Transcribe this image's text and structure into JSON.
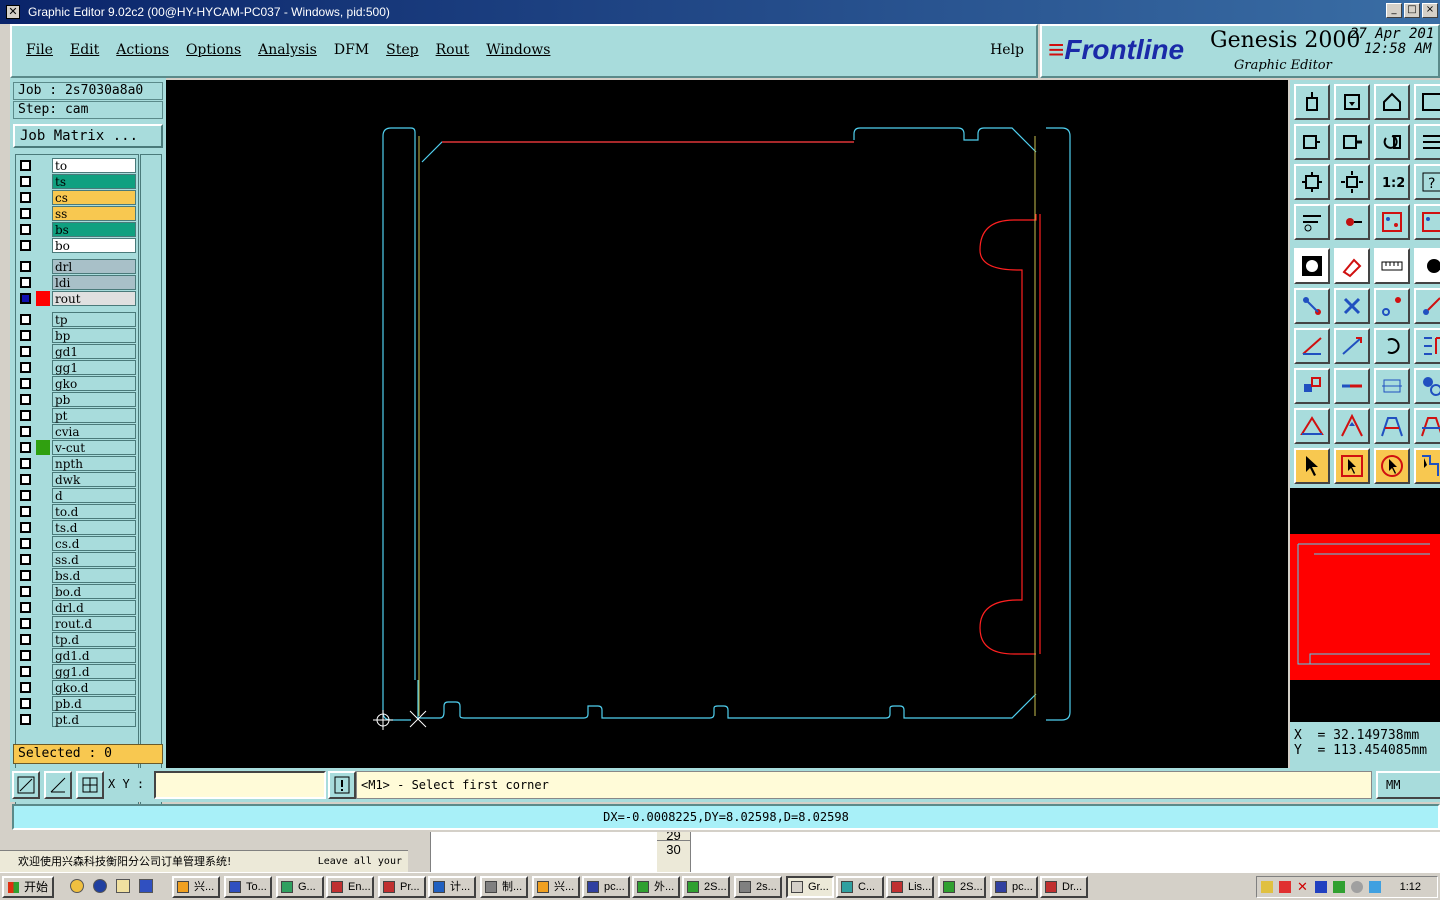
{
  "window": {
    "title": "Graphic Editor 9.02c2 (00@HY-HYCAM-PC037 - Windows, pid:500)",
    "controls": [
      "_",
      "□",
      "×"
    ]
  },
  "menu": {
    "items": [
      "File",
      "Edit",
      "Actions",
      "Options",
      "Analysis",
      "DFM",
      "Step",
      "Rout",
      "Windows"
    ],
    "help": "Help"
  },
  "brand": {
    "logo": "Frontline",
    "product": "Genesis 2000",
    "subtitle": "Graphic Editor",
    "date": "27 Apr 201",
    "time": "12:58 AM"
  },
  "job": {
    "job_label": "Job : 2s7030a8a0",
    "step_label": "Step: cam",
    "matrix_button": "Job Matrix ..."
  },
  "layers": [
    {
      "name": "to",
      "color": "#ffffff",
      "selected": false,
      "swatch": ""
    },
    {
      "name": "ts",
      "color": "#10a080",
      "selected": false,
      "swatch": ""
    },
    {
      "name": "cs",
      "color": "#f8c850",
      "selected": false,
      "swatch": ""
    },
    {
      "name": "ss",
      "color": "#f8c850",
      "selected": false,
      "swatch": ""
    },
    {
      "name": "bs",
      "color": "#10a080",
      "selected": false,
      "swatch": ""
    },
    {
      "name": "bo",
      "color": "#ffffff",
      "selected": false,
      "swatch": ""
    },
    {
      "name": "drl",
      "color": "#a8c0c8",
      "selected": false,
      "swatch": ""
    },
    {
      "name": "ldi",
      "color": "#a8c0c8",
      "selected": false,
      "swatch": ""
    },
    {
      "name": "rout",
      "color": "#e0e0e0",
      "selected": true,
      "swatch": "#ff0000"
    },
    {
      "name": "tp",
      "color": "#a8dcdc",
      "selected": false,
      "swatch": ""
    },
    {
      "name": "bp",
      "color": "#a8dcdc",
      "selected": false,
      "swatch": ""
    },
    {
      "name": "gd1",
      "color": "#a8dcdc",
      "selected": false,
      "swatch": ""
    },
    {
      "name": "gg1",
      "color": "#a8dcdc",
      "selected": false,
      "swatch": ""
    },
    {
      "name": "gko",
      "color": "#a8dcdc",
      "selected": false,
      "swatch": ""
    },
    {
      "name": "pb",
      "color": "#a8dcdc",
      "selected": false,
      "swatch": ""
    },
    {
      "name": "pt",
      "color": "#a8dcdc",
      "selected": false,
      "swatch": ""
    },
    {
      "name": "cvia",
      "color": "#a8dcdc",
      "selected": false,
      "swatch": ""
    },
    {
      "name": "v-cut",
      "color": "#a8dcdc",
      "selected": false,
      "swatch": "#30a010"
    },
    {
      "name": "npth",
      "color": "#a8dcdc",
      "selected": false,
      "swatch": ""
    },
    {
      "name": "dwk",
      "color": "#a8dcdc",
      "selected": false,
      "swatch": ""
    },
    {
      "name": "d",
      "color": "#a8dcdc",
      "selected": false,
      "swatch": ""
    },
    {
      "name": "to.d",
      "color": "#a8dcdc",
      "selected": false,
      "swatch": ""
    },
    {
      "name": "ts.d",
      "color": "#a8dcdc",
      "selected": false,
      "swatch": ""
    },
    {
      "name": "cs.d",
      "color": "#a8dcdc",
      "selected": false,
      "swatch": ""
    },
    {
      "name": "ss.d",
      "color": "#a8dcdc",
      "selected": false,
      "swatch": ""
    },
    {
      "name": "bs.d",
      "color": "#a8dcdc",
      "selected": false,
      "swatch": ""
    },
    {
      "name": "bo.d",
      "color": "#a8dcdc",
      "selected": false,
      "swatch": ""
    },
    {
      "name": "drl.d",
      "color": "#a8dcdc",
      "selected": false,
      "swatch": ""
    },
    {
      "name": "rout.d",
      "color": "#a8dcdc",
      "selected": false,
      "swatch": ""
    },
    {
      "name": "tp.d",
      "color": "#a8dcdc",
      "selected": false,
      "swatch": ""
    },
    {
      "name": "gd1.d",
      "color": "#a8dcdc",
      "selected": false,
      "swatch": ""
    },
    {
      "name": "gg1.d",
      "color": "#a8dcdc",
      "selected": false,
      "swatch": ""
    },
    {
      "name": "gko.d",
      "color": "#a8dcdc",
      "selected": false,
      "swatch": ""
    },
    {
      "name": "pb.d",
      "color": "#a8dcdc",
      "selected": false,
      "swatch": ""
    },
    {
      "name": "pt.d",
      "color": "#a8dcdc",
      "selected": false,
      "swatch": ""
    }
  ],
  "selected_label": "Selected : 0",
  "coords": {
    "x": "X  = 32.149738mm",
    "y": "Y  = 113.454085mm"
  },
  "command": {
    "xy_label": "X Y :",
    "xy_value": "",
    "prompt": "<M1> - Select first corner",
    "units": "MM"
  },
  "measure": "DX=-0.0008225,DY=8.02598,D=8.02598",
  "background_window": {
    "message": "欢迎使用兴森科技衡阳分公司订单管理系统!",
    "message_right": "Leave all your",
    "row_29": "29",
    "row_30": "30"
  },
  "taskbar": {
    "start": "开始",
    "tasks": [
      "兴...",
      "To...",
      "G...",
      "En...",
      "Pr...",
      "计...",
      "制...",
      "兴...",
      "pc...",
      "外...",
      "2S...",
      "2s...",
      "Gr...",
      "C...",
      "Lis...",
      "2S...",
      "pc...",
      "Dr..."
    ],
    "active_task": "Gr...",
    "clock": "1:12"
  },
  "colors": {
    "panel": "#a8dcdc",
    "outline_cyan": "#50d0f0",
    "rout_red": "#ff2020",
    "vcut_green": "#80c040",
    "highlight_orange": "#f8c850"
  },
  "toolbar_icons": [
    "zoom-home-icon",
    "zoom-page-icon",
    "zoom-house-icon",
    "zoom-window-icon",
    "zoom-in-icon",
    "zoom-out-icon",
    "undo-view-icon",
    "scroll-icon",
    "fit-icon",
    "center-icon",
    "one-to-one-icon",
    "query-icon",
    "snap-icon",
    "key-icon",
    "layer-features-icon",
    "layer-features-2-icon",
    "fill-icon",
    "polygon-select-icon",
    "ruler-icon",
    "pad-icon",
    "connect-icon",
    "cross-icon",
    "point-icon",
    "line-point-icon",
    "line-red-icon",
    "line-blue-icon",
    "arc-icon",
    "split-icon",
    "move-icon",
    "horizontal-icon",
    "measure-icon",
    "cluster-icon",
    "triangle-icon",
    "triangle-pointer-icon",
    "trapezoid-icon",
    "trapezoid-cross-icon",
    "pointer-icon",
    "pointer-box-icon",
    "pointer-circle-icon",
    "pointer-chain-icon"
  ]
}
